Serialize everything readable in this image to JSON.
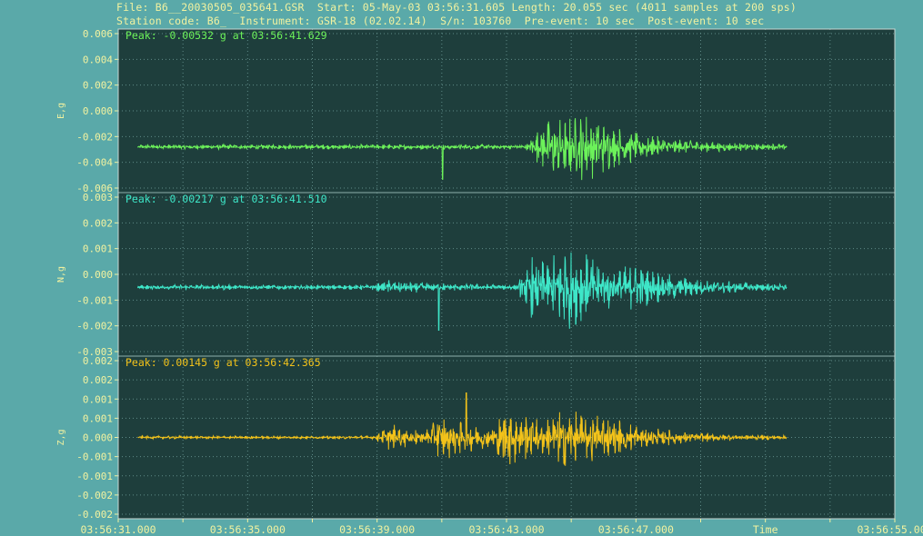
{
  "header": {
    "line1": "File: B6__20030505_035641.GSR  Start: 05-May-03 03:56:31.605 Length: 20.055 sec (4011 samples at 200 sps)",
    "line2": "Station code: B6_  Instrument: GSR-18 (02.02.14)  S/n: 103760  Pre-event: 10 sec  Post-event: 10 sec"
  },
  "colors": {
    "background": "#5aa9a9",
    "plot_bg": "#1e3e3c",
    "grid": "#5e8a86",
    "E": "#6cf25a",
    "N": "#3ee6c8",
    "Z": "#f2c21a",
    "axis_text": "#f2f2a0"
  },
  "chart_data": [
    {
      "type": "line",
      "channel": "E",
      "ylabel": "E,g",
      "peak_label": "Peak: -0.00532 g at 03:56:41.629",
      "ylim": [
        -0.006,
        0.006
      ],
      "yticks": [
        "0.006",
        "0.004",
        "0.002",
        "0.000",
        "-0.002",
        "-0.004",
        "-0.006"
      ],
      "baseline": -0.0028,
      "noise_amp": 0.0002,
      "event": [
        {
          "t": 13.1,
          "amp": 0.0016
        },
        {
          "t": 13.6,
          "amp": 0.0014
        },
        {
          "t": 14.4,
          "amp": 0.0012
        }
      ],
      "peak": {
        "t": 10.024,
        "value": -0.00532
      }
    },
    {
      "type": "line",
      "channel": "N",
      "ylabel": "N,g",
      "peak_label": "Peak: -0.00217 g at 03:56:41.510",
      "ylim": [
        -0.003,
        0.003
      ],
      "yticks": [
        "0.003",
        "0.002",
        "0.001",
        "0.000",
        "-0.001",
        "-0.002",
        "-0.003"
      ],
      "baseline": -0.0005,
      "noise_amp": 0.0001,
      "event": [
        {
          "t": 8.3,
          "amp": 0.0002
        },
        {
          "t": 12.8,
          "amp": 0.0012
        },
        {
          "t": 13.8,
          "amp": 0.0013
        },
        {
          "t": 16.0,
          "amp": 0.0004
        }
      ],
      "peak": {
        "t": 9.905,
        "value": -0.00217
      }
    },
    {
      "type": "line",
      "channel": "Z",
      "ylabel": "Z,g",
      "peak_label": "Peak: 0.00145 g at 03:56:42.365",
      "ylim": [
        -0.0025,
        0.0025
      ],
      "yticks": [
        "0.002",
        "0.002",
        "0.001",
        "0.001",
        "0.000",
        "-0.001",
        "-0.001",
        "-0.002",
        "-0.002"
      ],
      "baseline": 0.0,
      "noise_amp": 5e-05,
      "event": [
        {
          "t": 8.4,
          "amp": 0.0004
        },
        {
          "t": 10.0,
          "amp": 0.0006
        },
        {
          "t": 12.0,
          "amp": 0.0009
        },
        {
          "t": 13.7,
          "amp": 0.0007
        },
        {
          "t": 14.8,
          "amp": 0.0003
        }
      ],
      "peak": {
        "t": 10.76,
        "value": 0.00145
      }
    }
  ],
  "x_axis": {
    "label": "Time",
    "tick_labels": [
      "03:56:31.000",
      "03:56:35.000",
      "03:56:39.000",
      "03:56:43.000",
      "03:56:47.000",
      "03:56:55.000"
    ],
    "tick_seconds": [
      0,
      4,
      8,
      12,
      16,
      24
    ],
    "range_seconds": [
      0,
      24
    ],
    "data_start_seconds": 0.605,
    "data_length_seconds": 20.055
  }
}
